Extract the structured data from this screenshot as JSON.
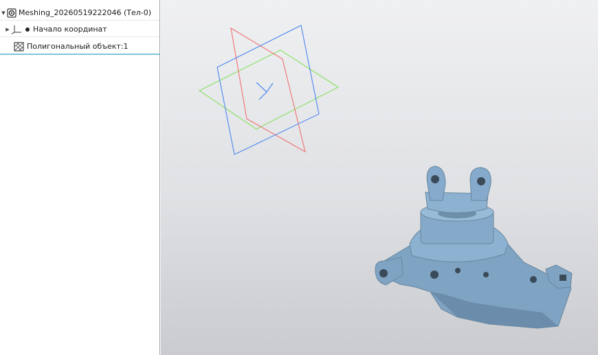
{
  "tree": {
    "root": {
      "label": "Meshing_20260519222046 (Тел-0)",
      "icon": "body-icon",
      "expanded": true
    },
    "items": [
      {
        "label": "Начало координат",
        "icon": "coordinate-origin-icon",
        "status_icon": "dot-icon",
        "collapsed": true
      },
      {
        "label": "Полигональный объект:1",
        "icon": "polygon-object-icon",
        "selected": true
      }
    ]
  },
  "viewport": {
    "planes": [
      {
        "name": "XY",
        "color": "#4a86f0"
      },
      {
        "name": "ZX",
        "color": "#f07070"
      },
      {
        "name": "YZ",
        "color": "#86e060"
      }
    ],
    "model": {
      "color": "#7fa3c3"
    }
  }
}
